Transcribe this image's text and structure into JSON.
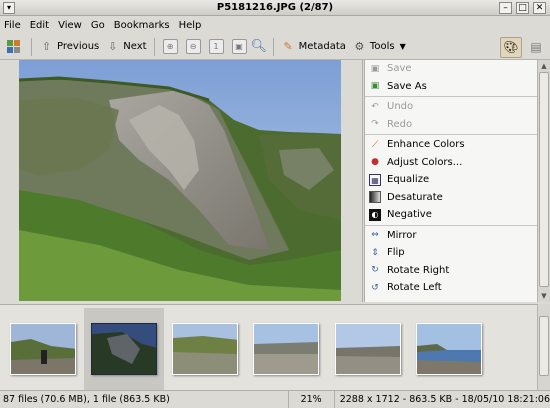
{
  "window": {
    "title": "P5181216.JPG (2/87)"
  },
  "menu": [
    "File",
    "Edit",
    "View",
    "Go",
    "Bookmarks",
    "Help"
  ],
  "toolbar": {
    "previous_label": "Previous",
    "next_label": "Next",
    "metadata_label": "Metadata",
    "tools_label": "Tools"
  },
  "tools_panel": {
    "items": [
      {
        "label": "Save",
        "icon": "save-icon",
        "enabled": false
      },
      {
        "label": "Save As",
        "icon": "save-as-icon",
        "enabled": true
      },
      {
        "label": "Undo",
        "icon": "undo-icon",
        "enabled": false
      },
      {
        "label": "Redo",
        "icon": "redo-icon",
        "enabled": false
      },
      {
        "label": "Enhance Colors",
        "icon": "wand-icon",
        "enabled": true
      },
      {
        "label": "Adjust Colors...",
        "icon": "palette-icon",
        "enabled": true
      },
      {
        "label": "Equalize",
        "icon": "equalize-icon",
        "enabled": true
      },
      {
        "label": "Desaturate",
        "icon": "desaturate-icon",
        "enabled": true
      },
      {
        "label": "Negative",
        "icon": "negative-icon",
        "enabled": true
      },
      {
        "label": "Mirror",
        "icon": "mirror-icon",
        "enabled": true
      },
      {
        "label": "Flip",
        "icon": "flip-icon",
        "enabled": true
      },
      {
        "label": "Rotate Right",
        "icon": "rotate-right-icon",
        "enabled": true
      },
      {
        "label": "Rotate Left",
        "icon": "rotate-left-icon",
        "enabled": true
      }
    ]
  },
  "status": {
    "files": "87 files (70.6 MB), 1 file (863.5 KB)",
    "zoom": "21%",
    "info": "2288 x 1712 - 863.5 KB - 18/05/10 18:21:06"
  }
}
